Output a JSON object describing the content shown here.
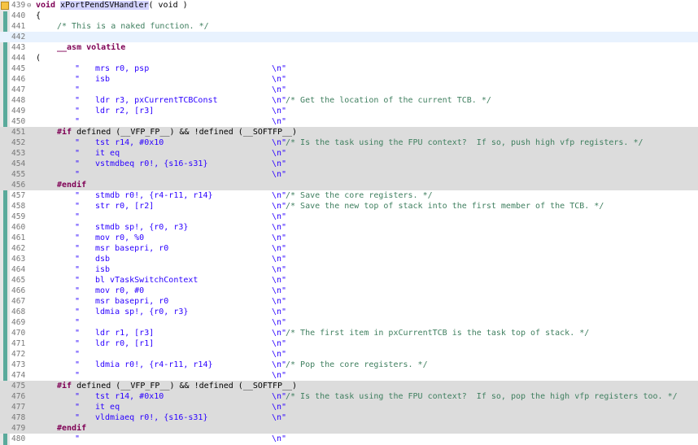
{
  "editor": {
    "lines": [
      {
        "n": "439",
        "kind": "sig",
        "ret": "void",
        "name": "xPortPendSVHandler",
        "rest": "( void )"
      },
      {
        "n": "440",
        "kind": "plain",
        "text": "{"
      },
      {
        "n": "441",
        "kind": "comment",
        "text": "/* This is a naked function. */"
      },
      {
        "n": "442",
        "kind": "blank",
        "cur": true
      },
      {
        "n": "443",
        "kind": "asm",
        "text": "__asm volatile"
      },
      {
        "n": "444",
        "kind": "plain",
        "text": "("
      },
      {
        "n": "445",
        "kind": "i",
        "ins": "mrs r0, psp",
        "cmt": ""
      },
      {
        "n": "446",
        "kind": "i",
        "ins": "isb",
        "cmt": ""
      },
      {
        "n": "447",
        "kind": "i",
        "ins": "",
        "cmt": ""
      },
      {
        "n": "448",
        "kind": "i",
        "ins": "ldr r3, pxCurrentTCBConst",
        "cmt": "/* Get the location of the current TCB. */"
      },
      {
        "n": "449",
        "kind": "i",
        "ins": "ldr r2, [r3]",
        "cmt": ""
      },
      {
        "n": "450",
        "kind": "i",
        "ins": "",
        "cmt": ""
      },
      {
        "n": "451",
        "kind": "pp",
        "text": "#if defined (__VFP_FP__) && !defined (__SOFTFP__)",
        "hl": true
      },
      {
        "n": "452",
        "kind": "i",
        "ins": "tst r14, #0x10",
        "cmt": "/* Is the task using the FPU context?  If so, push high vfp registers. */",
        "hl": true
      },
      {
        "n": "453",
        "kind": "i",
        "ins": "it eq",
        "cmt": "",
        "hl": true
      },
      {
        "n": "454",
        "kind": "i",
        "ins": "vstmdbeq r0!, {s16-s31}",
        "cmt": "",
        "hl": true
      },
      {
        "n": "455",
        "kind": "i",
        "ins": "",
        "cmt": "",
        "hl": true
      },
      {
        "n": "456",
        "kind": "pp",
        "text": "#endif",
        "hl": true
      },
      {
        "n": "457",
        "kind": "i",
        "ins": "stmdb r0!, {r4-r11, r14}",
        "cmt": "/* Save the core registers. */"
      },
      {
        "n": "458",
        "kind": "i",
        "ins": "str r0, [r2]",
        "cmt": "/* Save the new top of stack into the first member of the TCB. */"
      },
      {
        "n": "459",
        "kind": "i",
        "ins": "",
        "cmt": ""
      },
      {
        "n": "460",
        "kind": "i",
        "ins": "stmdb sp!, {r0, r3}",
        "cmt": ""
      },
      {
        "n": "461",
        "kind": "i",
        "ins": "mov r0, %0",
        "cmt": ""
      },
      {
        "n": "462",
        "kind": "i",
        "ins": "msr basepri, r0",
        "cmt": ""
      },
      {
        "n": "463",
        "kind": "i",
        "ins": "dsb",
        "cmt": ""
      },
      {
        "n": "464",
        "kind": "i",
        "ins": "isb",
        "cmt": ""
      },
      {
        "n": "465",
        "kind": "i",
        "ins": "bl vTaskSwitchContext",
        "cmt": ""
      },
      {
        "n": "466",
        "kind": "i",
        "ins": "mov r0, #0",
        "cmt": ""
      },
      {
        "n": "467",
        "kind": "i",
        "ins": "msr basepri, r0",
        "cmt": ""
      },
      {
        "n": "468",
        "kind": "i",
        "ins": "ldmia sp!, {r0, r3}",
        "cmt": ""
      },
      {
        "n": "469",
        "kind": "i",
        "ins": "",
        "cmt": ""
      },
      {
        "n": "470",
        "kind": "i",
        "ins": "ldr r1, [r3]",
        "cmt": "/* The first item in pxCurrentTCB is the task top of stack. */"
      },
      {
        "n": "471",
        "kind": "i",
        "ins": "ldr r0, [r1]",
        "cmt": ""
      },
      {
        "n": "472",
        "kind": "i",
        "ins": "",
        "cmt": ""
      },
      {
        "n": "473",
        "kind": "i",
        "ins": "ldmia r0!, {r4-r11, r14}",
        "cmt": "/* Pop the core registers. */"
      },
      {
        "n": "474",
        "kind": "i",
        "ins": "",
        "cmt": ""
      },
      {
        "n": "475",
        "kind": "pp",
        "text": "#if defined (__VFP_FP__) && !defined (__SOFTFP__)",
        "hl": true
      },
      {
        "n": "476",
        "kind": "i",
        "ins": "tst r14, #0x10",
        "cmt": "/* Is the task using the FPU context?  If so, pop the high vfp registers too. */",
        "hl": true
      },
      {
        "n": "477",
        "kind": "i",
        "ins": "it eq",
        "cmt": "",
        "hl": true
      },
      {
        "n": "478",
        "kind": "i",
        "ins": "vldmiaeq r0!, {s16-s31}",
        "cmt": "",
        "hl": true
      },
      {
        "n": "479",
        "kind": "pp",
        "text": "#endif",
        "hl": true
      },
      {
        "n": "480",
        "kind": "i",
        "ins": "",
        "cmt": ""
      }
    ],
    "quote": "\"",
    "newline": "\\n\""
  }
}
